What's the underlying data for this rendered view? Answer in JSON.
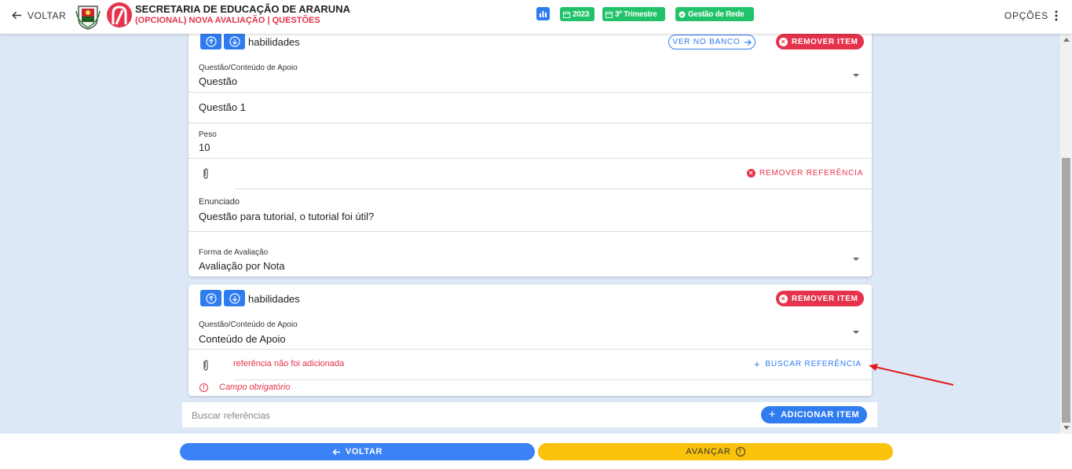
{
  "header": {
    "back_label": "VOLTAR",
    "title": "SECRETARIA DE EDUCAÇÃO DE ARARUNA",
    "subtitle": "(OPCIONAL) NOVA AVALIAÇÃO | QUESTÕES",
    "chips": {
      "year": "2023",
      "trimester": "3º Trimestre",
      "management": "Gestão de Rede"
    },
    "options_label": "OPÇÕES"
  },
  "item1": {
    "category": "habilidades",
    "ver_banco_label": "VER NO BANCO",
    "remove_label": "REMOVER ITEM",
    "type_label": "Questão/Conteúdo de Apoio",
    "type_value": "Questão",
    "question_name": "Questão 1",
    "weight_label": "Peso",
    "weight_value": "10",
    "remove_ref_label": "REMOVER REFERÊNCIA",
    "statement_label": "Enunciado",
    "statement_value": "Questão para tutorial, o tutorial foi útil?",
    "evaluation_label": "Forma de Avaliação",
    "evaluation_value": "Avaliação por Nota"
  },
  "item2": {
    "category": "habilidades",
    "remove_label": "REMOVER ITEM",
    "type_label": "Questão/Conteúdo de Apoio",
    "type_value": "Conteúdo de Apoio",
    "ref_error": "referência não foi adicionada",
    "buscar_label": "BUSCAR REFERÊNCIA",
    "required_msg": "Campo obrigatório"
  },
  "search": {
    "placeholder": "Buscar referências",
    "add_label": "ADICIONAR ITEM"
  },
  "footer": {
    "back_label": "VOLTAR",
    "next_label": "AVANÇAR"
  },
  "colors": {
    "primary": "#2f7cf0",
    "danger": "#e5334b",
    "success": "#21c26a",
    "warning": "#fbc20b",
    "page_bg": "#dde8f7"
  }
}
